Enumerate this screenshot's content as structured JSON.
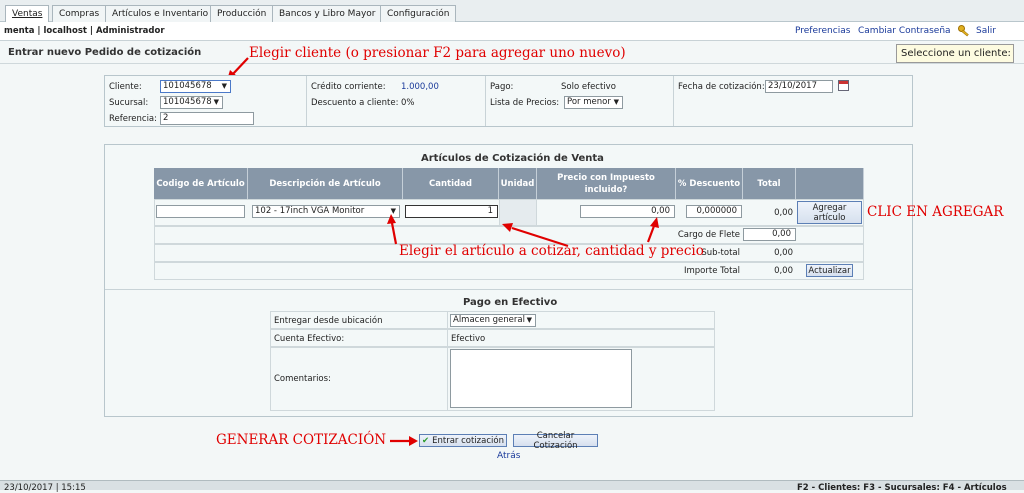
{
  "tabs": [
    {
      "label": "Ventas"
    },
    {
      "label": "Compras"
    },
    {
      "label": "Artículos e Inventario"
    },
    {
      "label": "Producción"
    },
    {
      "label": "Bancos y Libro Mayor"
    },
    {
      "label": "Configuración"
    }
  ],
  "userbar": {
    "info": "menta | localhost | Administrador",
    "preferences": "Preferencias",
    "change_password": "Cambiar Contraseña",
    "logout": "Salir"
  },
  "page": {
    "title": "Entrar nuevo Pedido de cotización",
    "hint": "Seleccione un cliente:"
  },
  "annotations": {
    "customer": "Elegir cliente (o presionar F2 para agregar uno nuevo)",
    "items": "Elegir el artículo a cotizar, cantidad y precio",
    "add": "CLIC EN AGREGAR",
    "generate": "GENERAR COTIZACIÓN"
  },
  "header_form": {
    "customer_label": "Cliente:",
    "customer_value": "101045678",
    "branch_label": "Sucursal:",
    "branch_value": "101045678",
    "reference_label": "Referencia:",
    "reference_value": "2",
    "credit_label": "Crédito corriente:",
    "credit_value": "1.000,00",
    "discount_label": "Descuento a cliente:",
    "discount_value": "0%",
    "payment_label": "Pago:",
    "payment_value": "Solo efectivo",
    "price_list_label": "Lista de Precios:",
    "price_list_value": "Por menor",
    "quote_date_label": "Fecha de cotización:",
    "quote_date_value": "23/10/2017"
  },
  "items_table": {
    "title": "Artículos de Cotización de Venta",
    "columns": [
      "Codigo de Artículo",
      "Descripción de Artículo",
      "Cantidad",
      "Unidad",
      "Precio con Impuesto incluido?",
      "% Descuento",
      "Total"
    ],
    "row": {
      "code": "",
      "description": "102 - 17inch VGA Monitor",
      "quantity": "1",
      "price": "0,00",
      "discount": "0,000000",
      "total": "0,00",
      "add_button": "Agregar artículo"
    },
    "freight_label": "Cargo de Flete",
    "freight_value": "0,00",
    "subtotal_label": "Sub-total",
    "subtotal_value": "0,00",
    "amount_total_label": "Importe Total",
    "amount_total_value": "0,00",
    "update_button": "Actualizar"
  },
  "payment": {
    "title": "Pago en Efectivo",
    "deliver_from_label": "Entregar desde ubicación",
    "deliver_from_value": "Almacen general",
    "cash_account_label": "Cuenta Efectivo:",
    "cash_account_value": "Efectivo",
    "comments_label": "Comentarios:",
    "comments_value": ""
  },
  "actions": {
    "enter_quote": "Entrar cotización",
    "cancel_quote": "Cancelar Cotización",
    "back": "Atrás"
  },
  "statusbar": {
    "datetime": "23/10/2017 | 15:15",
    "shortcuts": "F2 - Clientes: F3 - Sucursales: F4 - Artículos"
  },
  "colors": {
    "annotation": "#e00000",
    "header_bg": "#8797a8",
    "link": "#1a3a9a"
  }
}
